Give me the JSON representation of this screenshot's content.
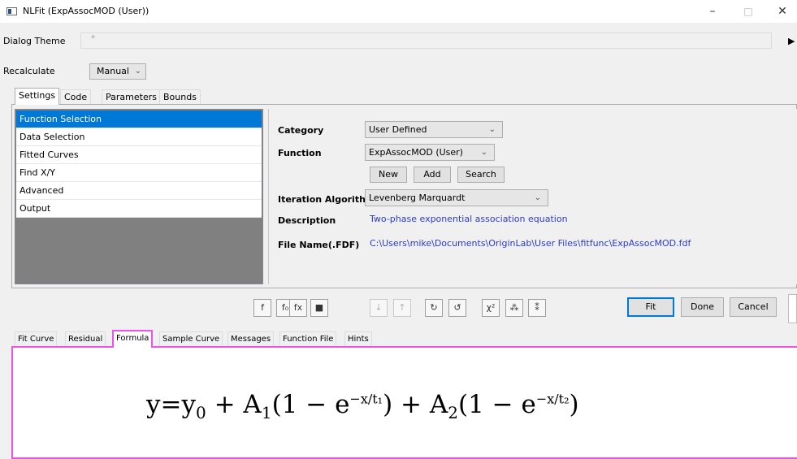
{
  "window": {
    "title": "NLFit (ExpAssocMOD (User))",
    "controls": {
      "minimize": "–",
      "maximize": "□",
      "close": "✕"
    }
  },
  "theme": {
    "label": "Dialog Theme",
    "value": "*",
    "arrow": "▶"
  },
  "recalculate": {
    "label": "Recalculate",
    "value": "Manual"
  },
  "top_tabs": [
    {
      "label": "Settings",
      "active": true
    },
    {
      "label": "Code"
    },
    {
      "label": "Parameters"
    },
    {
      "label": "Bounds"
    }
  ],
  "settings_list": [
    {
      "label": "Function Selection",
      "selected": true
    },
    {
      "label": "Data Selection"
    },
    {
      "label": "Fitted Curves"
    },
    {
      "label": "Find X/Y"
    },
    {
      "label": "Advanced"
    },
    {
      "label": "Output"
    }
  ],
  "function_selection": {
    "category_label": "Category",
    "category_value": "User Defined",
    "function_label": "Function",
    "function_value": "ExpAssocMOD (User)",
    "buttons": {
      "new": "New",
      "add": "Add",
      "search": "Search"
    },
    "iteration_label": "Iteration Algorithm",
    "iteration_value": "Levenberg Marquardt",
    "description_label": "Description",
    "description_value": "Two-phase exponential association equation",
    "filename_label": "File Name(.FDF)",
    "filename_value": "C:\\Users\\mike\\Documents\\OriginLab\\User Files\\fitfunc\\ExpAssocMOD.fdf"
  },
  "toolbar_icons": [
    {
      "name": "fx-param-icon",
      "glyph": "f",
      "disabled": false
    },
    {
      "name": "fx-init-icon",
      "glyph": "f₀",
      "disabled": false
    },
    {
      "name": "fx-edit-icon",
      "glyph": "fx",
      "disabled": false
    },
    {
      "name": "save-icon",
      "glyph": "■",
      "disabled": false
    },
    {
      "name": "fix-param-icon",
      "glyph": "↓",
      "disabled": true
    },
    {
      "name": "share-param-icon",
      "glyph": "↑",
      "disabled": true
    },
    {
      "name": "one-iteration-icon",
      "glyph": "↻",
      "disabled": false
    },
    {
      "name": "fit-until-converged-icon",
      "glyph": "↺",
      "disabled": false
    },
    {
      "name": "chi-square-icon",
      "glyph": "χ²",
      "disabled": false
    },
    {
      "name": "find-peaks-icon",
      "glyph": "⁂",
      "disabled": false
    },
    {
      "name": "peak-settings-icon",
      "glyph": "⁑",
      "disabled": false
    }
  ],
  "actions": {
    "fit": "Fit",
    "done": "Done",
    "cancel": "Cancel"
  },
  "bottom_tabs": [
    {
      "label": "Fit Curve"
    },
    {
      "label": "Residual"
    },
    {
      "label": "Formula",
      "active": true
    },
    {
      "label": "Sample Curve"
    },
    {
      "label": "Messages"
    },
    {
      "label": "Function File"
    },
    {
      "label": "Hints"
    }
  ],
  "formula": {
    "lhs": "y=y",
    "y_sub": "0",
    "plus1": " + A",
    "a1_sub": "1",
    "term1": "(1 − e",
    "exp1": "−x/t₁",
    "close1": ") + A",
    "a2_sub": "2",
    "term2": "(1 − e",
    "exp2": "−x/t₂",
    "close2": ")"
  }
}
